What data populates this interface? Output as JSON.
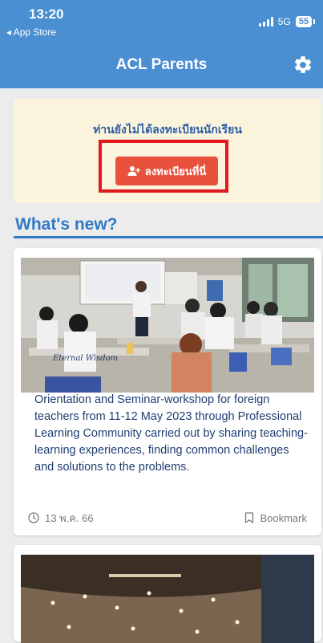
{
  "status_bar": {
    "time": "13:20",
    "back_label": "◂ App Store",
    "network": "5G",
    "battery": "55"
  },
  "nav": {
    "title": "ACL Parents",
    "settings_icon": "gear-icon"
  },
  "notice": {
    "message": "ท่านยังไม่ได้ลงทะเบียนนักเรียน",
    "button_label": "ลงทะเบียนที่นี่",
    "button_icon": "add-user-icon"
  },
  "section": {
    "title": "What's new?"
  },
  "news": [
    {
      "description": "Orientation and Seminar-workshop for foreign teachers from 11-12 May 2023 through Professional Learning Community carried out by sharing teaching-learning experiences, finding common challenges and solutions to the problems.",
      "date": "13 พ.ค. 66",
      "bookmark_label": "Bookmark",
      "photo_caption": "Eternal Wisdom"
    }
  ],
  "colors": {
    "header": "#4a8fd1",
    "accent_blue": "#2f79c6",
    "button": "#e8513c",
    "highlight_border": "#e0191f",
    "notice_bg": "#fbf3dc"
  }
}
